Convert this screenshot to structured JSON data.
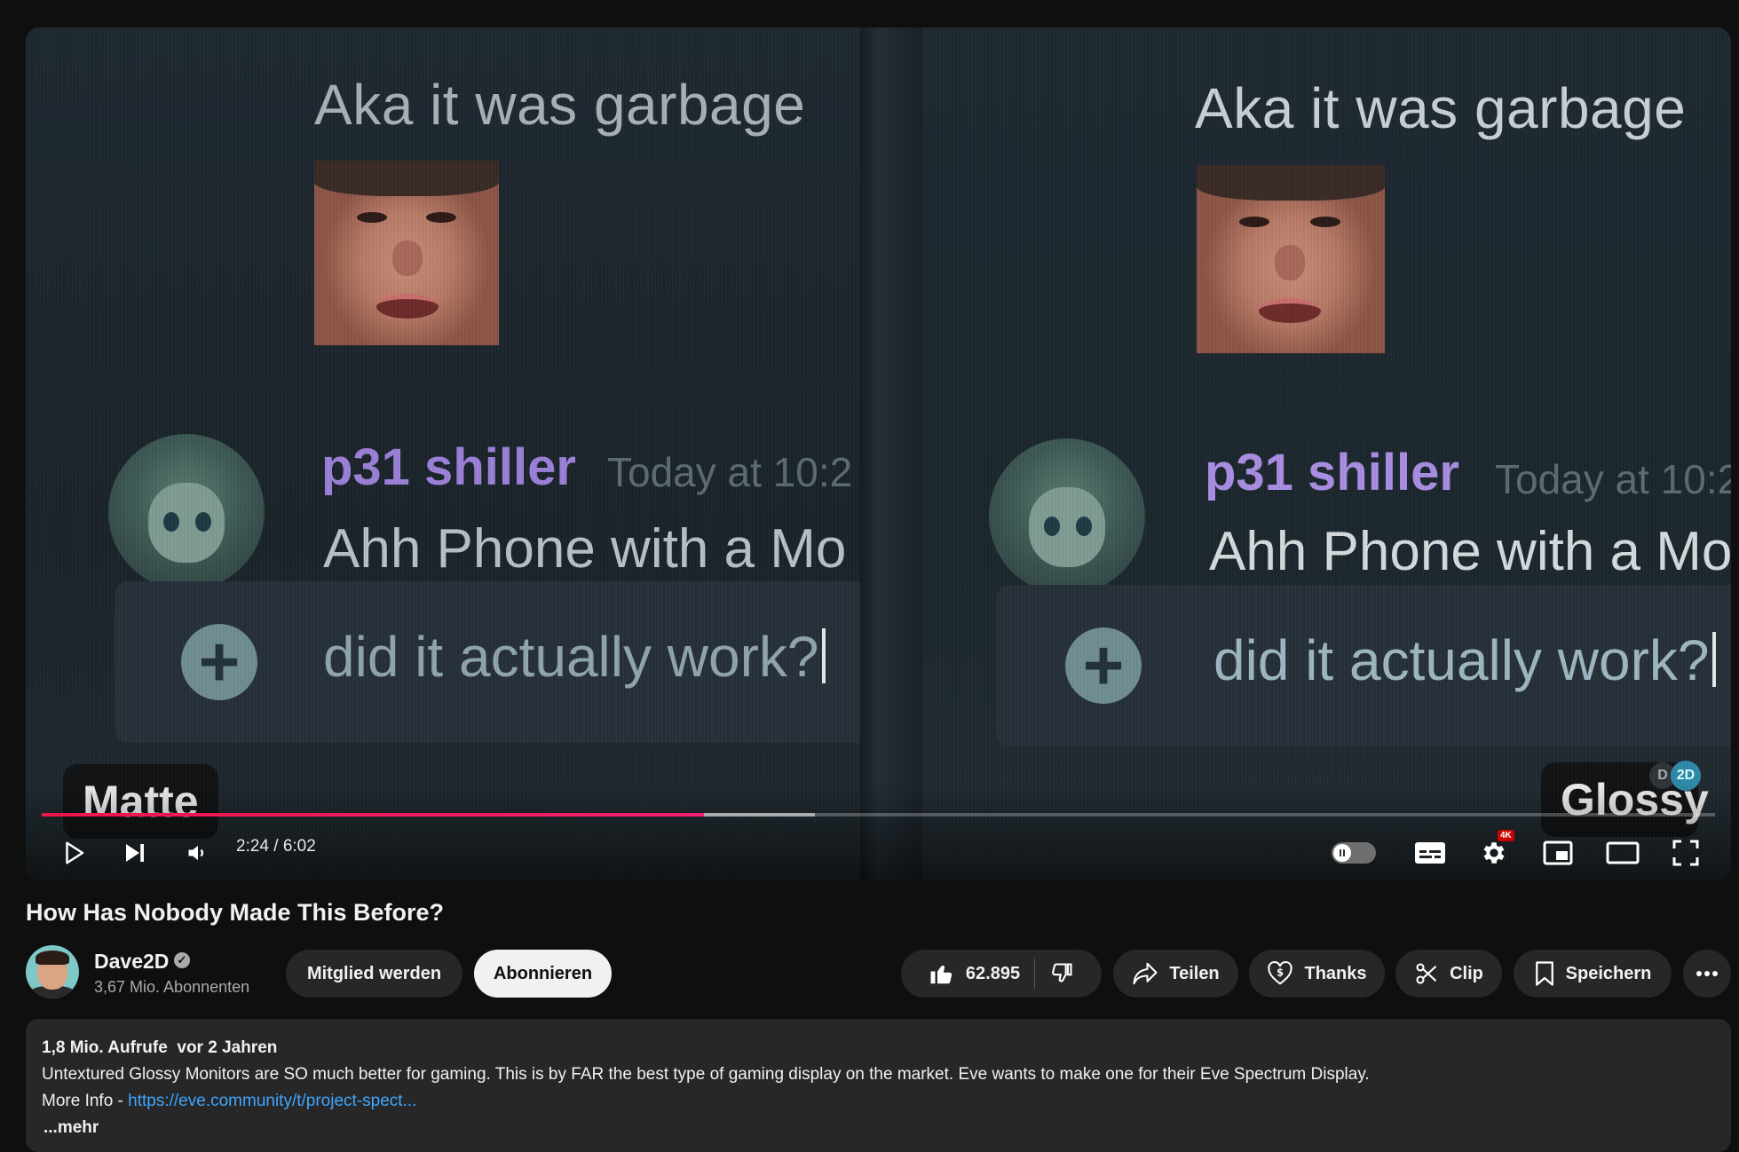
{
  "video": {
    "left_frame": {
      "message_text": "Aka it was garbage",
      "username": "p31 shiller",
      "timestamp": "Today at 10:2",
      "message2": "Ahh Phone with a Mo",
      "typed_text": "did it actually work?",
      "label": "Matte"
    },
    "right_frame": {
      "message_text": "Aka it was garbage",
      "username": "p31 shiller",
      "timestamp": "Today at 10:2",
      "message2": "Ahh Phone with a Mo",
      "typed_text": "did it actually work?",
      "label": "Glossy"
    },
    "watermark": {
      "left": "D",
      "right": "2D"
    }
  },
  "player": {
    "timecode": "2:24 / 6:02",
    "progress": 0.396,
    "buffered": 0.462,
    "quality_badge": "4K",
    "accent_color": "#ff0050",
    "icons": [
      "play-icon",
      "next-icon",
      "volume-icon",
      "autoplay-toggle",
      "subtitles-icon",
      "settings-icon",
      "miniplayer-icon",
      "theater-icon",
      "fullscreen-icon"
    ]
  },
  "title": "How Has Nobody Made This Before?",
  "channel": {
    "name": "Dave2D",
    "subscribers": "3,67 Mio. Abonnenten",
    "join_label": "Mitglied werden",
    "subscribe_label": "Abonnieren"
  },
  "actions": {
    "likes": "62.895",
    "share": "Teilen",
    "thanks": "Thanks",
    "clip": "Clip",
    "save": "Speichern"
  },
  "description": {
    "views": "1,8 Mio. Aufrufe",
    "age": "vor 2 Jahren",
    "text": "Untextured Glossy Monitors are SO much better for gaming. This is by FAR the best type of gaming display on the market. Eve wants to make one for their Eve Spectrum Display.",
    "more_info_prefix": "More Info - ",
    "link": "https://eve.community/t/project-spect...",
    "more": "...mehr"
  }
}
